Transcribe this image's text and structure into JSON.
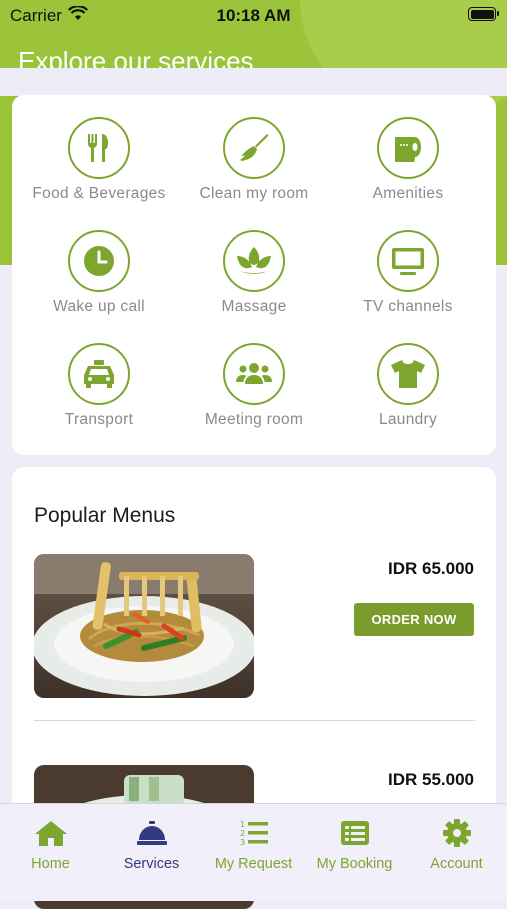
{
  "status_bar": {
    "carrier": "Carrier",
    "time": "10:18 AM"
  },
  "header": {
    "title": "Explore our services"
  },
  "services": [
    {
      "label": "Food & Beverages",
      "icon": "utensils-icon"
    },
    {
      "label": "Clean my room",
      "icon": "broom-icon"
    },
    {
      "label": "Amenities",
      "icon": "toilet-paper-icon"
    },
    {
      "label": "Wake up call",
      "icon": "clock-icon"
    },
    {
      "label": "Massage",
      "icon": "spa-icon"
    },
    {
      "label": "TV channels",
      "icon": "tv-icon"
    },
    {
      "label": "Transport",
      "icon": "taxi-icon"
    },
    {
      "label": "Meeting room",
      "icon": "users-icon"
    },
    {
      "label": "Laundry",
      "icon": "tshirt-icon"
    }
  ],
  "popular_menus": {
    "title": "Popular Menus",
    "items": [
      {
        "price": "IDR 65.000",
        "button": "ORDER NOW"
      },
      {
        "price": "IDR 55.000"
      }
    ]
  },
  "tabs": [
    {
      "label": "Home",
      "icon": "home-icon"
    },
    {
      "label": "Services",
      "icon": "concierge-bell-icon",
      "active": true
    },
    {
      "label": "My Request",
      "icon": "numbered-list-icon"
    },
    {
      "label": "My Booking",
      "icon": "list-alt-icon"
    },
    {
      "label": "Account",
      "icon": "gear-icon"
    }
  ],
  "colors": {
    "accent": "#9cc43a",
    "button": "#7a9c2c",
    "active_tab": "#333a80",
    "icon": "#7da62f"
  }
}
